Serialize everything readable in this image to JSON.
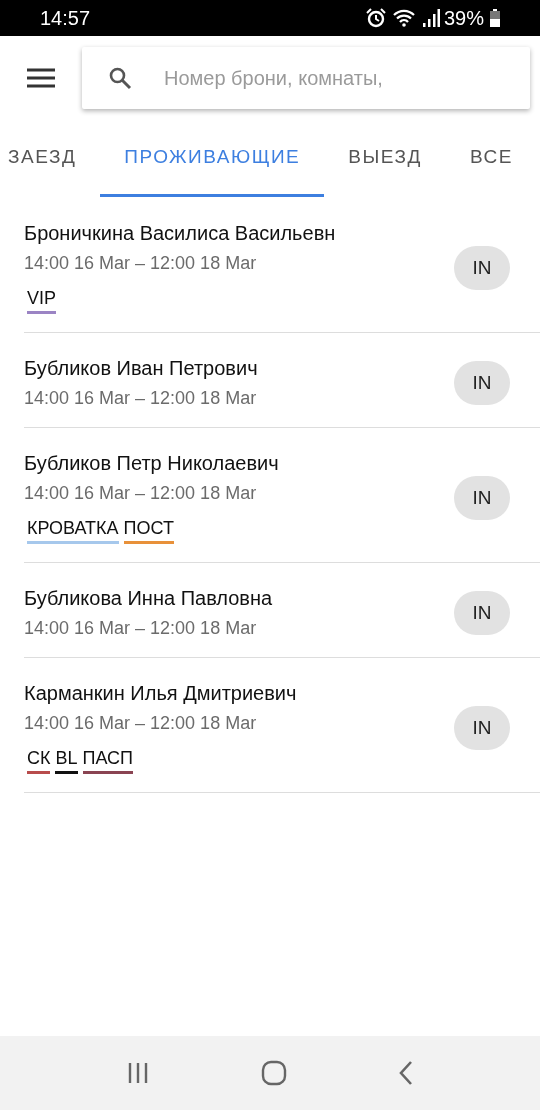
{
  "status_bar": {
    "time": "14:57",
    "battery": "39%"
  },
  "search": {
    "placeholder": "Номер брони, комнаты,"
  },
  "tabs": [
    {
      "label": "ЗАЕЗД",
      "selected": false
    },
    {
      "label": "ПРОЖИВАЮЩИЕ",
      "selected": true
    },
    {
      "label": "ВЫЕЗД",
      "selected": false
    },
    {
      "label": "ВСЕ",
      "selected": false
    }
  ],
  "guests": [
    {
      "name": "Броничкина Василиса Васильевн",
      "dates": "14:00 16 Mar – 12:00 18 Mar",
      "status": "IN",
      "tags": [
        {
          "label": "VIP",
          "color": "#9b84c4"
        }
      ]
    },
    {
      "name": "Бубликов Иван Петрович",
      "dates": "14:00 16 Mar – 12:00 18 Mar",
      "status": "IN"
    },
    {
      "name": "Бубликов Петр Николаевич",
      "dates": "14:00 16 Mar – 12:00 18 Mar",
      "status": "IN",
      "tags": [
        {
          "label": "КРОВАТКА",
          "color": "#a6c8ec"
        },
        {
          "label": "ПОСТ",
          "color": "#e8913a"
        }
      ]
    },
    {
      "name": "Бубликова Инна Павловна",
      "dates": "14:00 16 Mar – 12:00 18 Mar",
      "status": "IN"
    },
    {
      "name": "Карманкин Илья Дмитриевич",
      "dates": "14:00 16 Mar – 12:00 18 Mar",
      "status": "IN",
      "tags": [
        {
          "label": "СК",
          "color": "#b84c4c"
        },
        {
          "label": "BL",
          "color": "#111111"
        },
        {
          "label": "ПАСП",
          "color": "#8a4452"
        }
      ]
    }
  ]
}
